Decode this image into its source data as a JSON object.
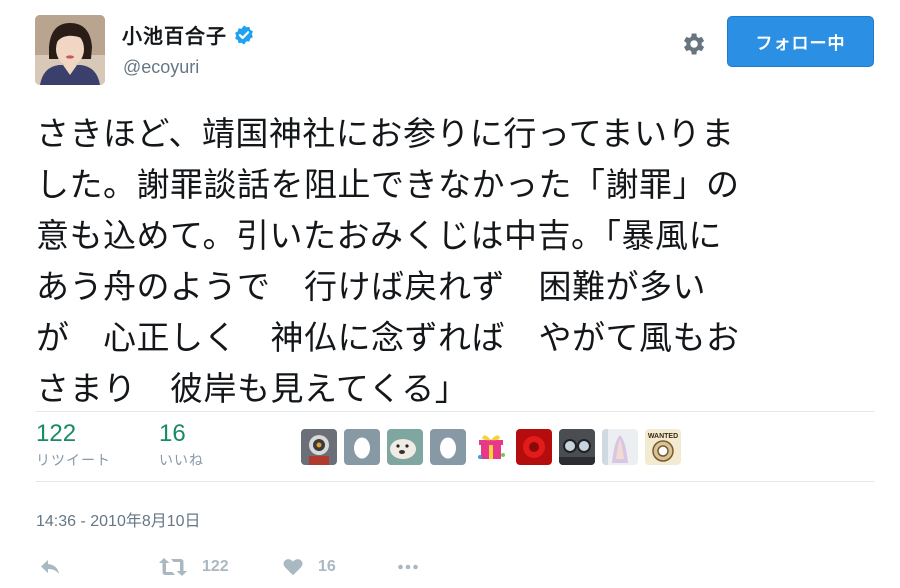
{
  "user": {
    "display_name": "小池百合子",
    "handle": "@ecoyuri",
    "verified": true
  },
  "header": {
    "settings_icon": "gear-icon",
    "follow_label": "フォロー中"
  },
  "tweet": {
    "lines": [
      "さきほど、靖国神社にお参りに行ってまいりま",
      "した。謝罪談話を阻止できなかった「謝罪」の",
      "意も込めて。引いたおみくじは中吉。「暴風に",
      "あう舟のようで　行けば戻れず　困難が多い",
      "が　心正しく　神仏に念ずれば　やがて風もお",
      "さまり　彼岸も見えてくる」"
    ]
  },
  "stats": {
    "retweets": {
      "count": "122",
      "label": "リツイート"
    },
    "likes": {
      "count": "16",
      "label": "いいね"
    }
  },
  "timestamp": "14:36 - 2010年8月10日",
  "liker_avatars": [
    {
      "name": "liker-avatar-robot"
    },
    {
      "name": "liker-avatar-egg"
    },
    {
      "name": "liker-avatar-dog"
    },
    {
      "name": "liker-avatar-egg"
    },
    {
      "name": "liker-avatar-gift"
    },
    {
      "name": "liker-avatar-red"
    },
    {
      "name": "liker-avatar-glasses"
    },
    {
      "name": "liker-avatar-drawing"
    },
    {
      "name": "liker-avatar-wanted"
    }
  ],
  "liker_wanted_text": "WANTED",
  "actions": {
    "reply_icon": "reply-icon",
    "retweet_icon": "retweet-icon",
    "retweet_count": "122",
    "like_icon": "heart-icon",
    "like_count": "16",
    "more_icon": "more-icon"
  },
  "colors": {
    "accent": "#2b8fe4",
    "stat_count": "#1a8a62",
    "muted": "#657786",
    "action_gray": "#aab8c2"
  }
}
